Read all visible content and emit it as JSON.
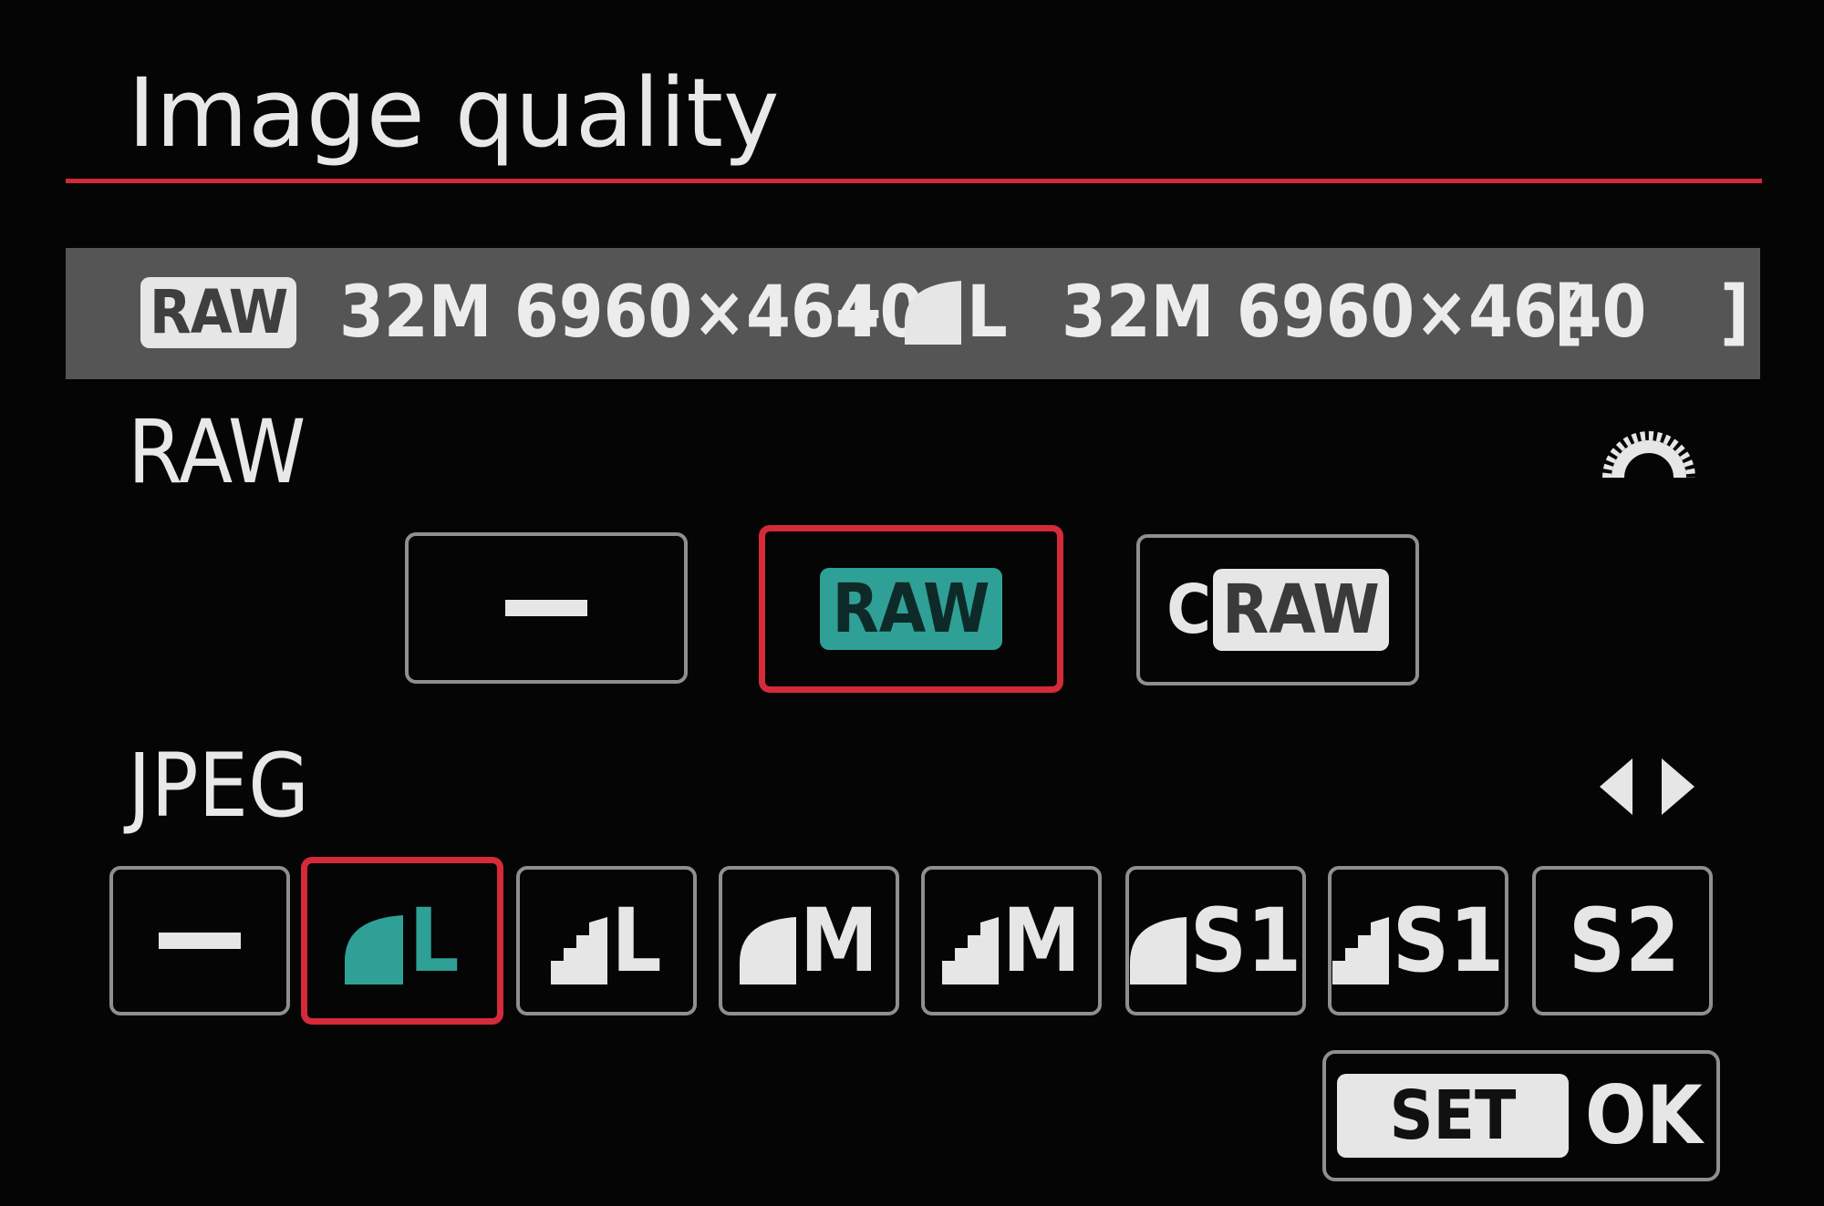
{
  "header": {
    "title": "Image quality"
  },
  "summary": {
    "raw_badge": "RAW",
    "raw_size": "32M 6960×4640",
    "plus": "+",
    "jpeg_quality_letter": "L",
    "jpeg_size": "32M 6960×4640",
    "bracket_open": "[",
    "bracket_content": "",
    "bracket_close": "]"
  },
  "raw_section": {
    "label": "RAW",
    "control_icon": "main-dial-icon",
    "options": [
      {
        "id": "none",
        "label": "—",
        "icon": "dash-icon",
        "selected": false
      },
      {
        "id": "raw",
        "label": "RAW",
        "selected": true
      },
      {
        "id": "craw_c",
        "label": "C",
        "selected": false
      },
      {
        "id": "craw_raw",
        "label": "RAW",
        "selected": false
      }
    ]
  },
  "jpeg_section": {
    "label": "JPEG",
    "control_icon": "left-right-arrows-icon",
    "options": [
      {
        "id": "none",
        "icon": "dash-icon",
        "letter": "",
        "selected": false
      },
      {
        "id": "fine-l",
        "icon": "fine-quality-icon",
        "letter": "L",
        "selected": true
      },
      {
        "id": "normal-l",
        "icon": "normal-quality-icon",
        "letter": "L",
        "selected": false
      },
      {
        "id": "fine-m",
        "icon": "fine-quality-icon",
        "letter": "M",
        "selected": false
      },
      {
        "id": "normal-m",
        "icon": "normal-quality-icon",
        "letter": "M",
        "selected": false
      },
      {
        "id": "fine-s1",
        "icon": "fine-quality-icon",
        "letter": "S1",
        "selected": false
      },
      {
        "id": "normal-s1",
        "icon": "normal-quality-icon",
        "letter": "S1",
        "selected": false
      },
      {
        "id": "s2",
        "icon": "",
        "letter": "S2",
        "selected": false
      }
    ]
  },
  "footer": {
    "set_label": "SET",
    "ok_label": "OK"
  },
  "colors": {
    "accent_red": "#d42a3a",
    "selection_teal": "#2fa095",
    "bar_gray": "#555555",
    "border_gray": "#8f8f8f",
    "text_light": "#e6e6e6"
  }
}
